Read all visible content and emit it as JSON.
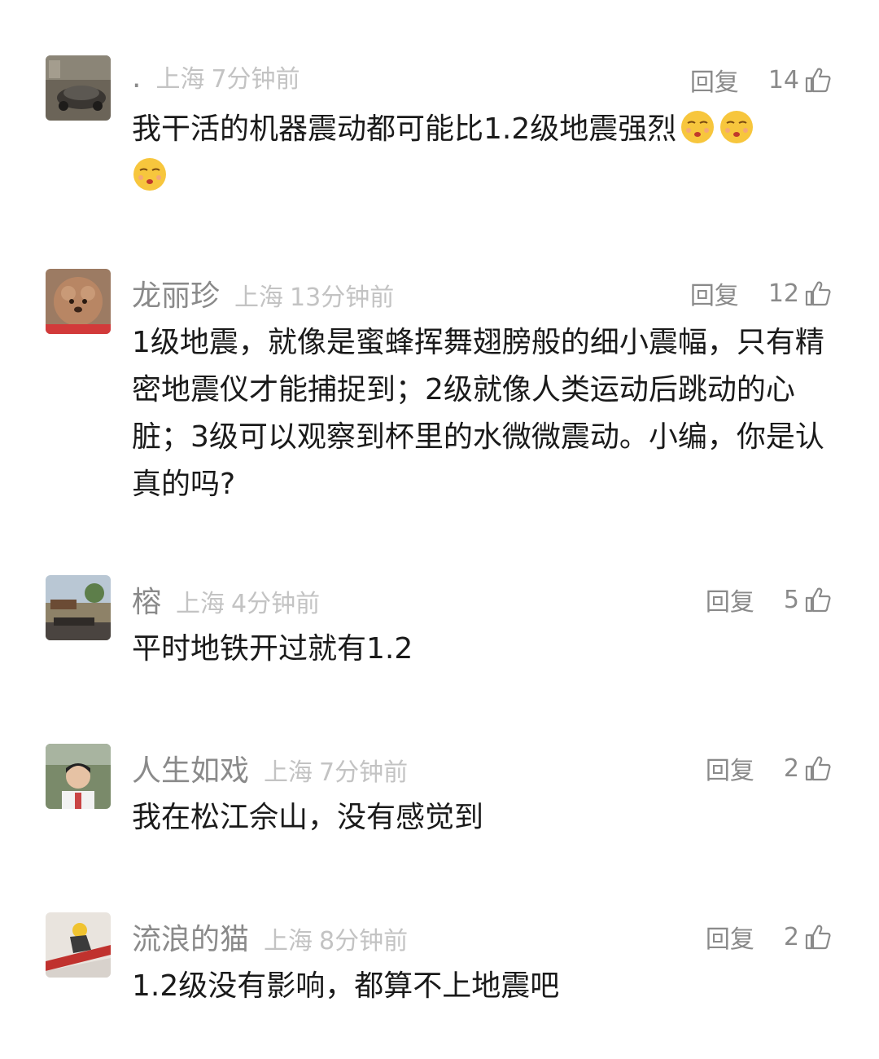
{
  "comments": [
    {
      "username": ".",
      "location": "上海",
      "time": "7分钟前",
      "reply_label": "回复",
      "likes": "14",
      "text": "我干活的机器震动都可能比1.2级地震强烈",
      "emoji_count": 3,
      "emoji": "shushing-face"
    },
    {
      "username": "龙丽珍",
      "location": "上海",
      "time": "13分钟前",
      "reply_label": "回复",
      "likes": "12",
      "text": "1级地震，就像是蜜蜂挥舞翅膀般的细小震幅，只有精密地震仪才能捕捉到；2级就像人类运动后跳动的心脏；3级可以观察到杯里的水微微震动。小编，你是认真的吗?"
    },
    {
      "username": "榕",
      "location": "上海",
      "time": "4分钟前",
      "reply_label": "回复",
      "likes": "5",
      "text": "平时地铁开过就有1.2"
    },
    {
      "username": "人生如戏",
      "location": "上海",
      "time": "7分钟前",
      "reply_label": "回复",
      "likes": "2",
      "text": "我在松江佘山，没有感觉到"
    },
    {
      "username": "流浪的猫",
      "location": "上海",
      "time": "8分钟前",
      "reply_label": "回复",
      "likes": "2",
      "text": "1.2级没有影响，都算不上地震吧"
    }
  ],
  "colors": {
    "username": "#8a8a8a",
    "meta": "#c3c3c3",
    "text": "#1a1a1a"
  },
  "icons": {
    "like": "thumbs-up-icon"
  }
}
